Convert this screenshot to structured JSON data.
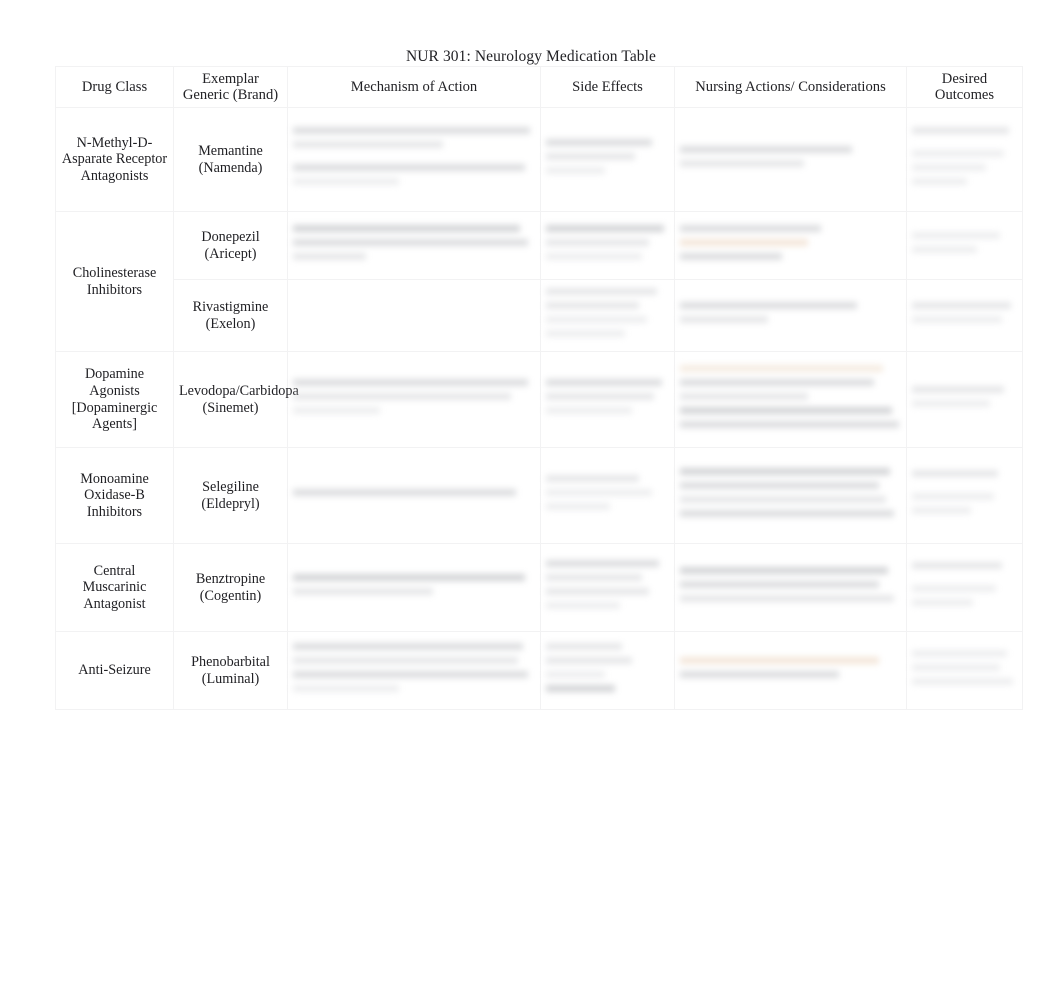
{
  "document": {
    "title": "NUR 301: Neurology Medication Table"
  },
  "table": {
    "headers": [
      "Drug Class",
      "Exemplar\nGeneric (Brand)",
      "Mechanism of Action",
      "Side Effects",
      "Nursing Actions/ Considerations",
      "Desired\nOutcomes"
    ],
    "header_lines": {
      "drug_class": "Drug Class",
      "exemplar_line1": "Exemplar",
      "exemplar_line2": "Generic (Brand)",
      "mechanism": "Mechanism of Action",
      "side_effects": "Side Effects",
      "nursing": "Nursing Actions/ Considerations",
      "outcomes_line1": "Desired",
      "outcomes_line2": "Outcomes"
    },
    "rows": [
      {
        "drug_class": "N-Methyl-D-Asparate Receptor Antagonists",
        "exemplar": "Memantine (Namenda)",
        "content_legible": false
      },
      {
        "drug_class": "Cholinesterase Inhibitors",
        "exemplar": "Donepezil (Aricept)",
        "content_legible": false
      },
      {
        "drug_class": "",
        "exemplar": "Rivastigmine (Exelon)",
        "content_legible": false
      },
      {
        "drug_class": "Dopamine Agonists [Dopaminergic Agents]",
        "exemplar": "Levodopa/Carbidopa (Sinemet)",
        "content_legible": false
      },
      {
        "drug_class": "Monoamine Oxidase-B Inhibitors",
        "exemplar": "Selegiline (Eldepryl)",
        "content_legible": false
      },
      {
        "drug_class": "Central Muscarinic Antagonist",
        "exemplar": "Benztropine (Cogentin)",
        "content_legible": false
      },
      {
        "drug_class": "Anti-Seizure",
        "exemplar": "Phenobarbital (Luminal)",
        "content_legible": false
      }
    ]
  },
  "colors": {
    "page_background": "#ffffff",
    "text": "#1f1f23",
    "border": "#f2f2f3",
    "redacted_text": "#b9bbbf",
    "highlight": "#e8cdb4"
  }
}
